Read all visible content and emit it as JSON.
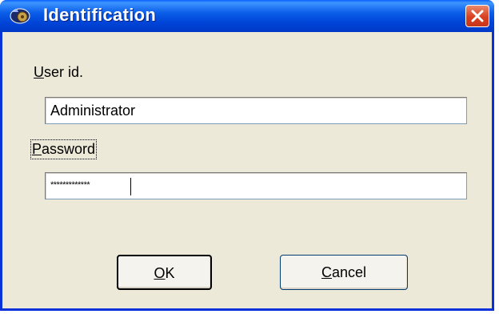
{
  "window": {
    "title": "Identification",
    "app_icon": "identification-gear-icon",
    "close_icon": "close-icon"
  },
  "user": {
    "label_mnemonic": "U",
    "label_rest": "ser id.",
    "value": "Administrator"
  },
  "password": {
    "label_mnemonic": "P",
    "label_rest": "assword",
    "masked_value": "*************"
  },
  "buttons": {
    "ok_mnemonic": "O",
    "ok_rest": "K",
    "cancel_mnemonic": "C",
    "cancel_rest": "ancel"
  },
  "colors": {
    "titlebar": "#0054e3",
    "dialog_background": "#ece9d8",
    "close_button": "#d8401f"
  }
}
